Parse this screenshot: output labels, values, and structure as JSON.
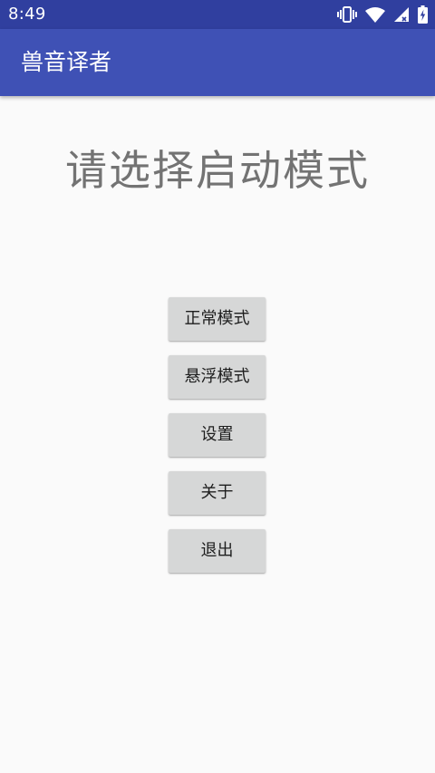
{
  "status_bar": {
    "time": "8:49",
    "icons": [
      "vibrate-icon",
      "wifi-icon",
      "cellular-signal-icon",
      "battery-charging-icon"
    ]
  },
  "app_bar": {
    "title": "兽音译者"
  },
  "main": {
    "heading": "请选择启动模式",
    "buttons": [
      {
        "label": "正常模式"
      },
      {
        "label": "悬浮模式"
      },
      {
        "label": "设置"
      },
      {
        "label": "关于"
      },
      {
        "label": "退出"
      }
    ]
  },
  "colors": {
    "status_bar": "#303f9f",
    "app_bar": "#3f51b5",
    "background": "#fafafa",
    "button": "#d6d7d7",
    "heading_text": "#737373"
  }
}
